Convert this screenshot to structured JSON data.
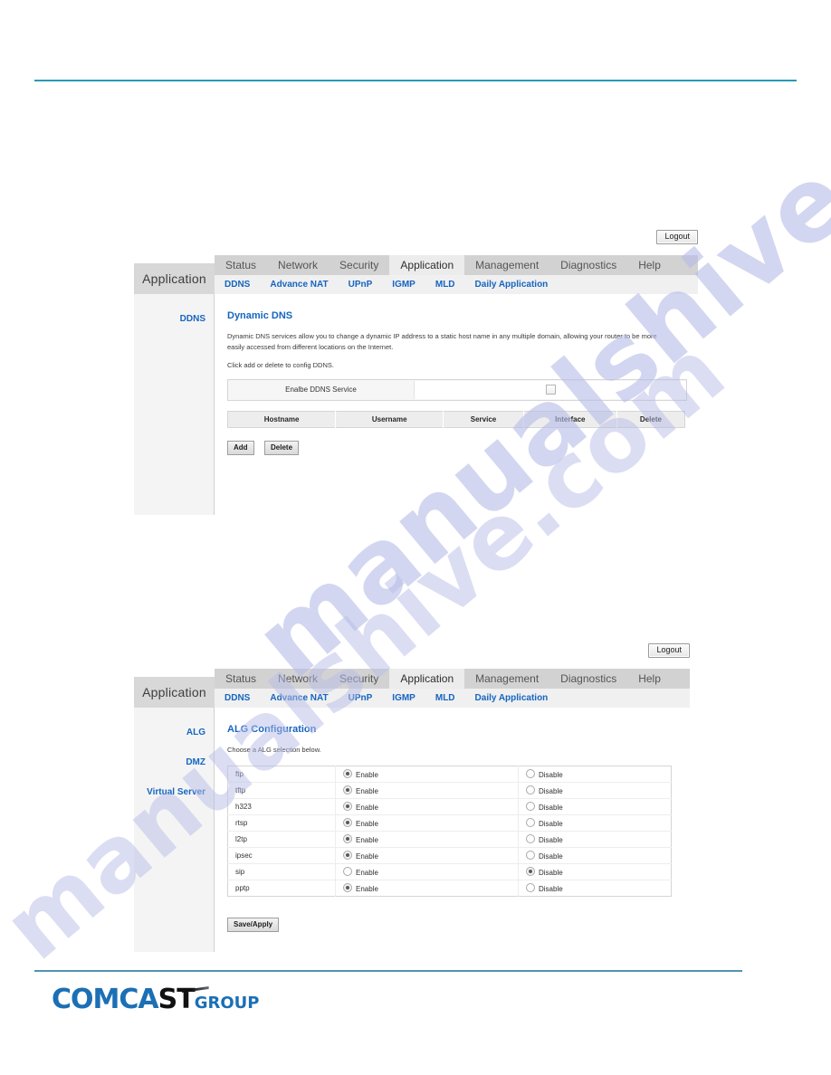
{
  "watermark": {
    "line1": "manualshive.com",
    "line2": "manualshive.com"
  },
  "logo": {
    "part1": "COMCA",
    "part2": "ST",
    "part3": "GROUP"
  },
  "nav": {
    "brand": "Application",
    "logout_label": "Logout",
    "top_items": [
      {
        "label": "Status",
        "active": false
      },
      {
        "label": "Network",
        "active": false
      },
      {
        "label": "Security",
        "active": false
      },
      {
        "label": "Application",
        "active": true
      },
      {
        "label": "Management",
        "active": false
      },
      {
        "label": "Diagnostics",
        "active": false
      },
      {
        "label": "Help",
        "active": false
      }
    ],
    "sub_items": [
      {
        "label": "DDNS"
      },
      {
        "label": "Advance NAT"
      },
      {
        "label": "UPnP"
      },
      {
        "label": "IGMP"
      },
      {
        "label": "MLD"
      },
      {
        "label": "Daily Application"
      }
    ]
  },
  "panel_ddns": {
    "sidebar": [
      {
        "label": "DDNS"
      }
    ],
    "title": "Dynamic DNS",
    "paragraph1": "Dynamic DNS services allow you to change a dynamic IP address to a static host name in any multiple domain, allowing your router to be more easily accessed from different locations on the Internet.",
    "paragraph2": "Click add or delete to config DDNS.",
    "enable_row": {
      "label": "Enalbe DDNS Service",
      "checked": false
    },
    "table_headers": [
      "Hostname",
      "Username",
      "Service",
      "Interface",
      "Delete"
    ],
    "buttons": [
      {
        "label": "Add"
      },
      {
        "label": "Delete"
      }
    ]
  },
  "panel_alg": {
    "sidebar": [
      {
        "label": "ALG"
      },
      {
        "label": "DMZ"
      },
      {
        "label": "Virtual Server"
      }
    ],
    "title": "ALG Configuration",
    "paragraph1": "Choose a ALG selection below.",
    "enable_label": "Enable",
    "disable_label": "Disable",
    "rows": [
      {
        "name": "ftp",
        "selected": "enable"
      },
      {
        "name": "tftp",
        "selected": "enable"
      },
      {
        "name": "h323",
        "selected": "enable"
      },
      {
        "name": "rtsp",
        "selected": "enable"
      },
      {
        "name": "l2tp",
        "selected": "enable"
      },
      {
        "name": "ipsec",
        "selected": "enable"
      },
      {
        "name": "sip",
        "selected": "disable"
      },
      {
        "name": "pptp",
        "selected": "enable"
      }
    ],
    "save_label": "Save/Apply"
  }
}
